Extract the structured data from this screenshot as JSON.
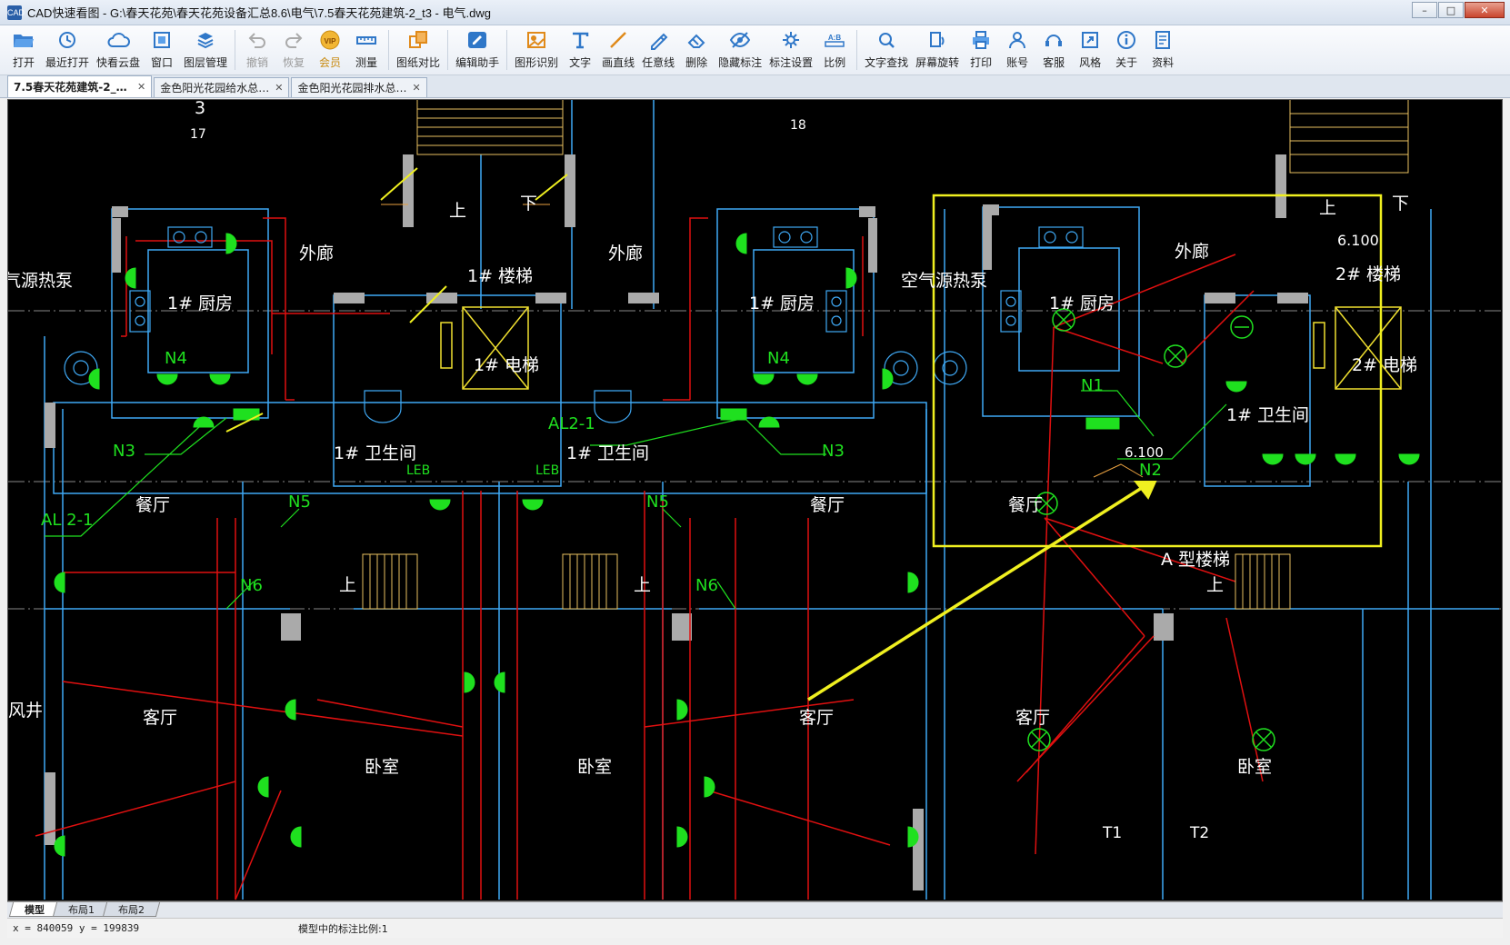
{
  "window": {
    "title": "CAD快速看图 - G:\\春天花苑\\春天花苑设备汇总8.6\\电气\\7.5春天花苑建筑-2_t3 - 电气.dwg",
    "app_icon_text": "CAD"
  },
  "toolbar": {
    "items": [
      {
        "label": "打开",
        "icon": "folder-open-icon"
      },
      {
        "label": "最近打开",
        "icon": "clock-icon"
      },
      {
        "label": "快看云盘",
        "icon": "cloud-icon"
      },
      {
        "label": "窗口",
        "icon": "window-icon"
      },
      {
        "label": "图层管理",
        "icon": "layers-icon"
      },
      {
        "label": "撤销",
        "icon": "undo-icon"
      },
      {
        "label": "恢复",
        "icon": "redo-icon"
      },
      {
        "label": "会员",
        "icon": "vip-icon"
      },
      {
        "label": "测量",
        "icon": "ruler-icon"
      },
      {
        "label": "图纸对比",
        "icon": "compare-icon"
      },
      {
        "label": "编辑助手",
        "icon": "edit-assistant-icon"
      },
      {
        "label": "图形识别",
        "icon": "shape-recognize-icon"
      },
      {
        "label": "文字",
        "icon": "text-icon"
      },
      {
        "label": "画直线",
        "icon": "line-icon"
      },
      {
        "label": "任意线",
        "icon": "freehand-icon"
      },
      {
        "label": "删除",
        "icon": "eraser-icon"
      },
      {
        "label": "隐藏标注",
        "icon": "eye-hide-icon"
      },
      {
        "label": "标注设置",
        "icon": "annotation-settings-icon"
      },
      {
        "label": "比例",
        "icon": "scale-icon"
      },
      {
        "label": "文字查找",
        "icon": "text-search-icon"
      },
      {
        "label": "屏幕旋转",
        "icon": "rotate-screen-icon"
      },
      {
        "label": "打印",
        "icon": "printer-icon"
      },
      {
        "label": "账号",
        "icon": "user-icon"
      },
      {
        "label": "客服",
        "icon": "headset-icon"
      },
      {
        "label": "风格",
        "icon": "style-icon"
      },
      {
        "label": "关于",
        "icon": "info-icon"
      },
      {
        "label": "资料",
        "icon": "document-icon"
      }
    ],
    "vip_badge": "VIP",
    "scale_badge": "A:B"
  },
  "tabs": [
    {
      "label": "7.5春天花苑建筑-2_t…",
      "active": true
    },
    {
      "label": "金色阳光花园给水总…",
      "active": false
    },
    {
      "label": "金色阳光花园排水总…",
      "active": false
    }
  ],
  "drawing": {
    "labels": {
      "n3": "3",
      "n17": "17",
      "n18": "18",
      "kitchen": "1# 厨房",
      "corridor": "外廊",
      "stair1": "1# 楼梯",
      "stair2": "2# 楼梯",
      "elevator1": "1# 电梯",
      "elevator2": "2# 电梯",
      "bath": "1# 卫生间",
      "dining": "餐厅",
      "living": "客厅",
      "bedroom": "卧室",
      "heatpump": "空气源热泵",
      "heatpump_left": "气源热泵",
      "up": "上",
      "down": "下",
      "n4": "N4",
      "n3lbl": "N3",
      "n5": "N5",
      "n6": "N6",
      "n1": "N1",
      "n2": "N2",
      "al21": "AL2-1",
      "al21_left": "AL 2-1",
      "leb": "LEB",
      "elev": "6.100",
      "a_stair": "A 型楼梯",
      "t1": "T1",
      "t2": "T2",
      "well": "风井"
    }
  },
  "layout_tabs": [
    {
      "label": "模型",
      "active": true
    },
    {
      "label": "布局1",
      "active": false
    },
    {
      "label": "布局2",
      "active": false
    }
  ],
  "status": {
    "coords": "x = 840059  y = 199839",
    "scale": "模型中的标注比例:1"
  }
}
